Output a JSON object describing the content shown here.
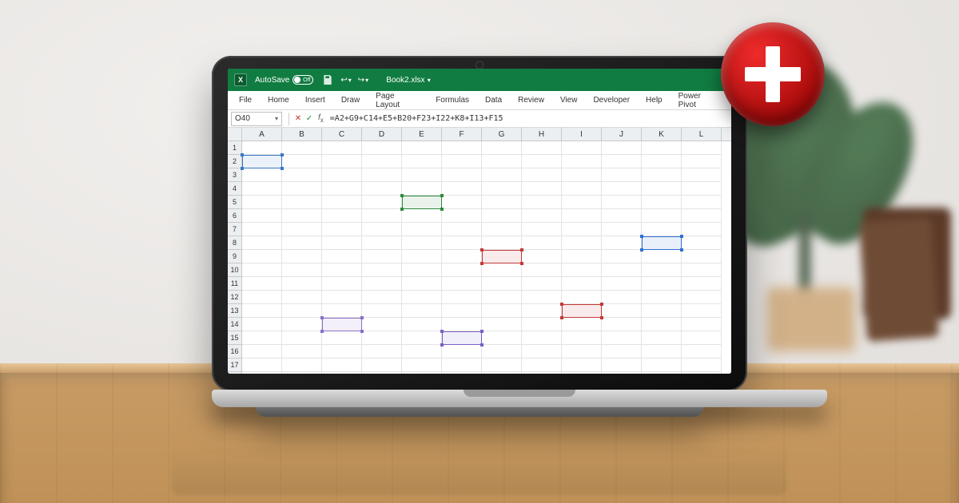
{
  "titlebar": {
    "autosave_label": "AutoSave",
    "autosave_toggle_text": "Off",
    "filename": "Book2.xlsx"
  },
  "ribbon": {
    "tabs": [
      "File",
      "Home",
      "Insert",
      "Draw",
      "Page Layout",
      "Formulas",
      "Data",
      "Review",
      "View",
      "Developer",
      "Help",
      "Power Pivot"
    ]
  },
  "formula_bar": {
    "name_box": "O40",
    "formula": "=A2+G9+C14+E5+B20+F23+I22+K8+I13+F15"
  },
  "grid": {
    "columns": [
      "A",
      "B",
      "C",
      "D",
      "E",
      "F",
      "G",
      "H",
      "I",
      "J",
      "K",
      "L"
    ],
    "row_count": 18
  },
  "highlights": [
    {
      "ref": "A2",
      "col": 0,
      "row": 2,
      "color": "#3a78c3"
    },
    {
      "ref": "E5",
      "col": 4,
      "row": 5,
      "color": "#2e8b3d"
    },
    {
      "ref": "K8",
      "col": 10,
      "row": 8,
      "color": "#2f6fd0"
    },
    {
      "ref": "G9",
      "col": 6,
      "row": 9,
      "color": "#c33a3a"
    },
    {
      "ref": "I13",
      "col": 8,
      "row": 13,
      "color": "#c33a3a"
    },
    {
      "ref": "C14",
      "col": 2,
      "row": 14,
      "color": "#8a6fc9"
    },
    {
      "ref": "F15",
      "col": 5,
      "row": 15,
      "color": "#7a5fc3"
    }
  ],
  "badge": {
    "icon": "plus",
    "color": "#c40c0c"
  }
}
